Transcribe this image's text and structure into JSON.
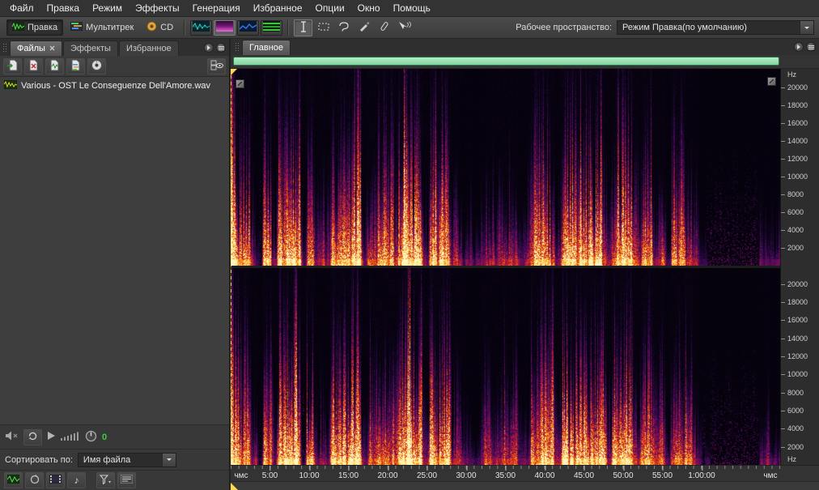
{
  "menubar": {
    "items": [
      "Файл",
      "Правка",
      "Режим",
      "Эффекты",
      "Генерация",
      "Избранное",
      "Опции",
      "Окно",
      "Помощь"
    ]
  },
  "toolbar": {
    "edit_view_label": "Правка",
    "multitrack_label": "Мультитрек",
    "cd_label": "CD",
    "workspace_label": "Рабочее пространство:",
    "workspace_value": "Режим Правка(по умолчанию)"
  },
  "files_panel": {
    "tab_files": "Файлы",
    "tab_effects": "Эффекты",
    "tab_favorites": "Избранное",
    "files": [
      {
        "name": "Various - OST Le Conseguenze Dell'Amore.wav"
      }
    ],
    "preview_counter": "0",
    "sort_label": "Сортировать по:",
    "sort_value": "Имя файла"
  },
  "main_panel": {
    "tab": "Главное",
    "freq_unit": "Hz",
    "freq_ticks": [
      20000,
      18000,
      16000,
      14000,
      12000,
      10000,
      8000,
      6000,
      4000,
      2000
    ],
    "freq_max": 22050,
    "timeline": {
      "edge_label": "чмс",
      "labels": [
        "5:00",
        "10:00",
        "15:00",
        "20:00",
        "25:00",
        "30:00",
        "35:00",
        "40:00",
        "45:00",
        "50:00",
        "55:00",
        "1:00:00"
      ],
      "total_minutes": 70
    }
  },
  "colors": {
    "navigator_green": "#8fdfa8",
    "playhead_yellow": "#ffd84a",
    "counter_green": "#3ad03a"
  }
}
